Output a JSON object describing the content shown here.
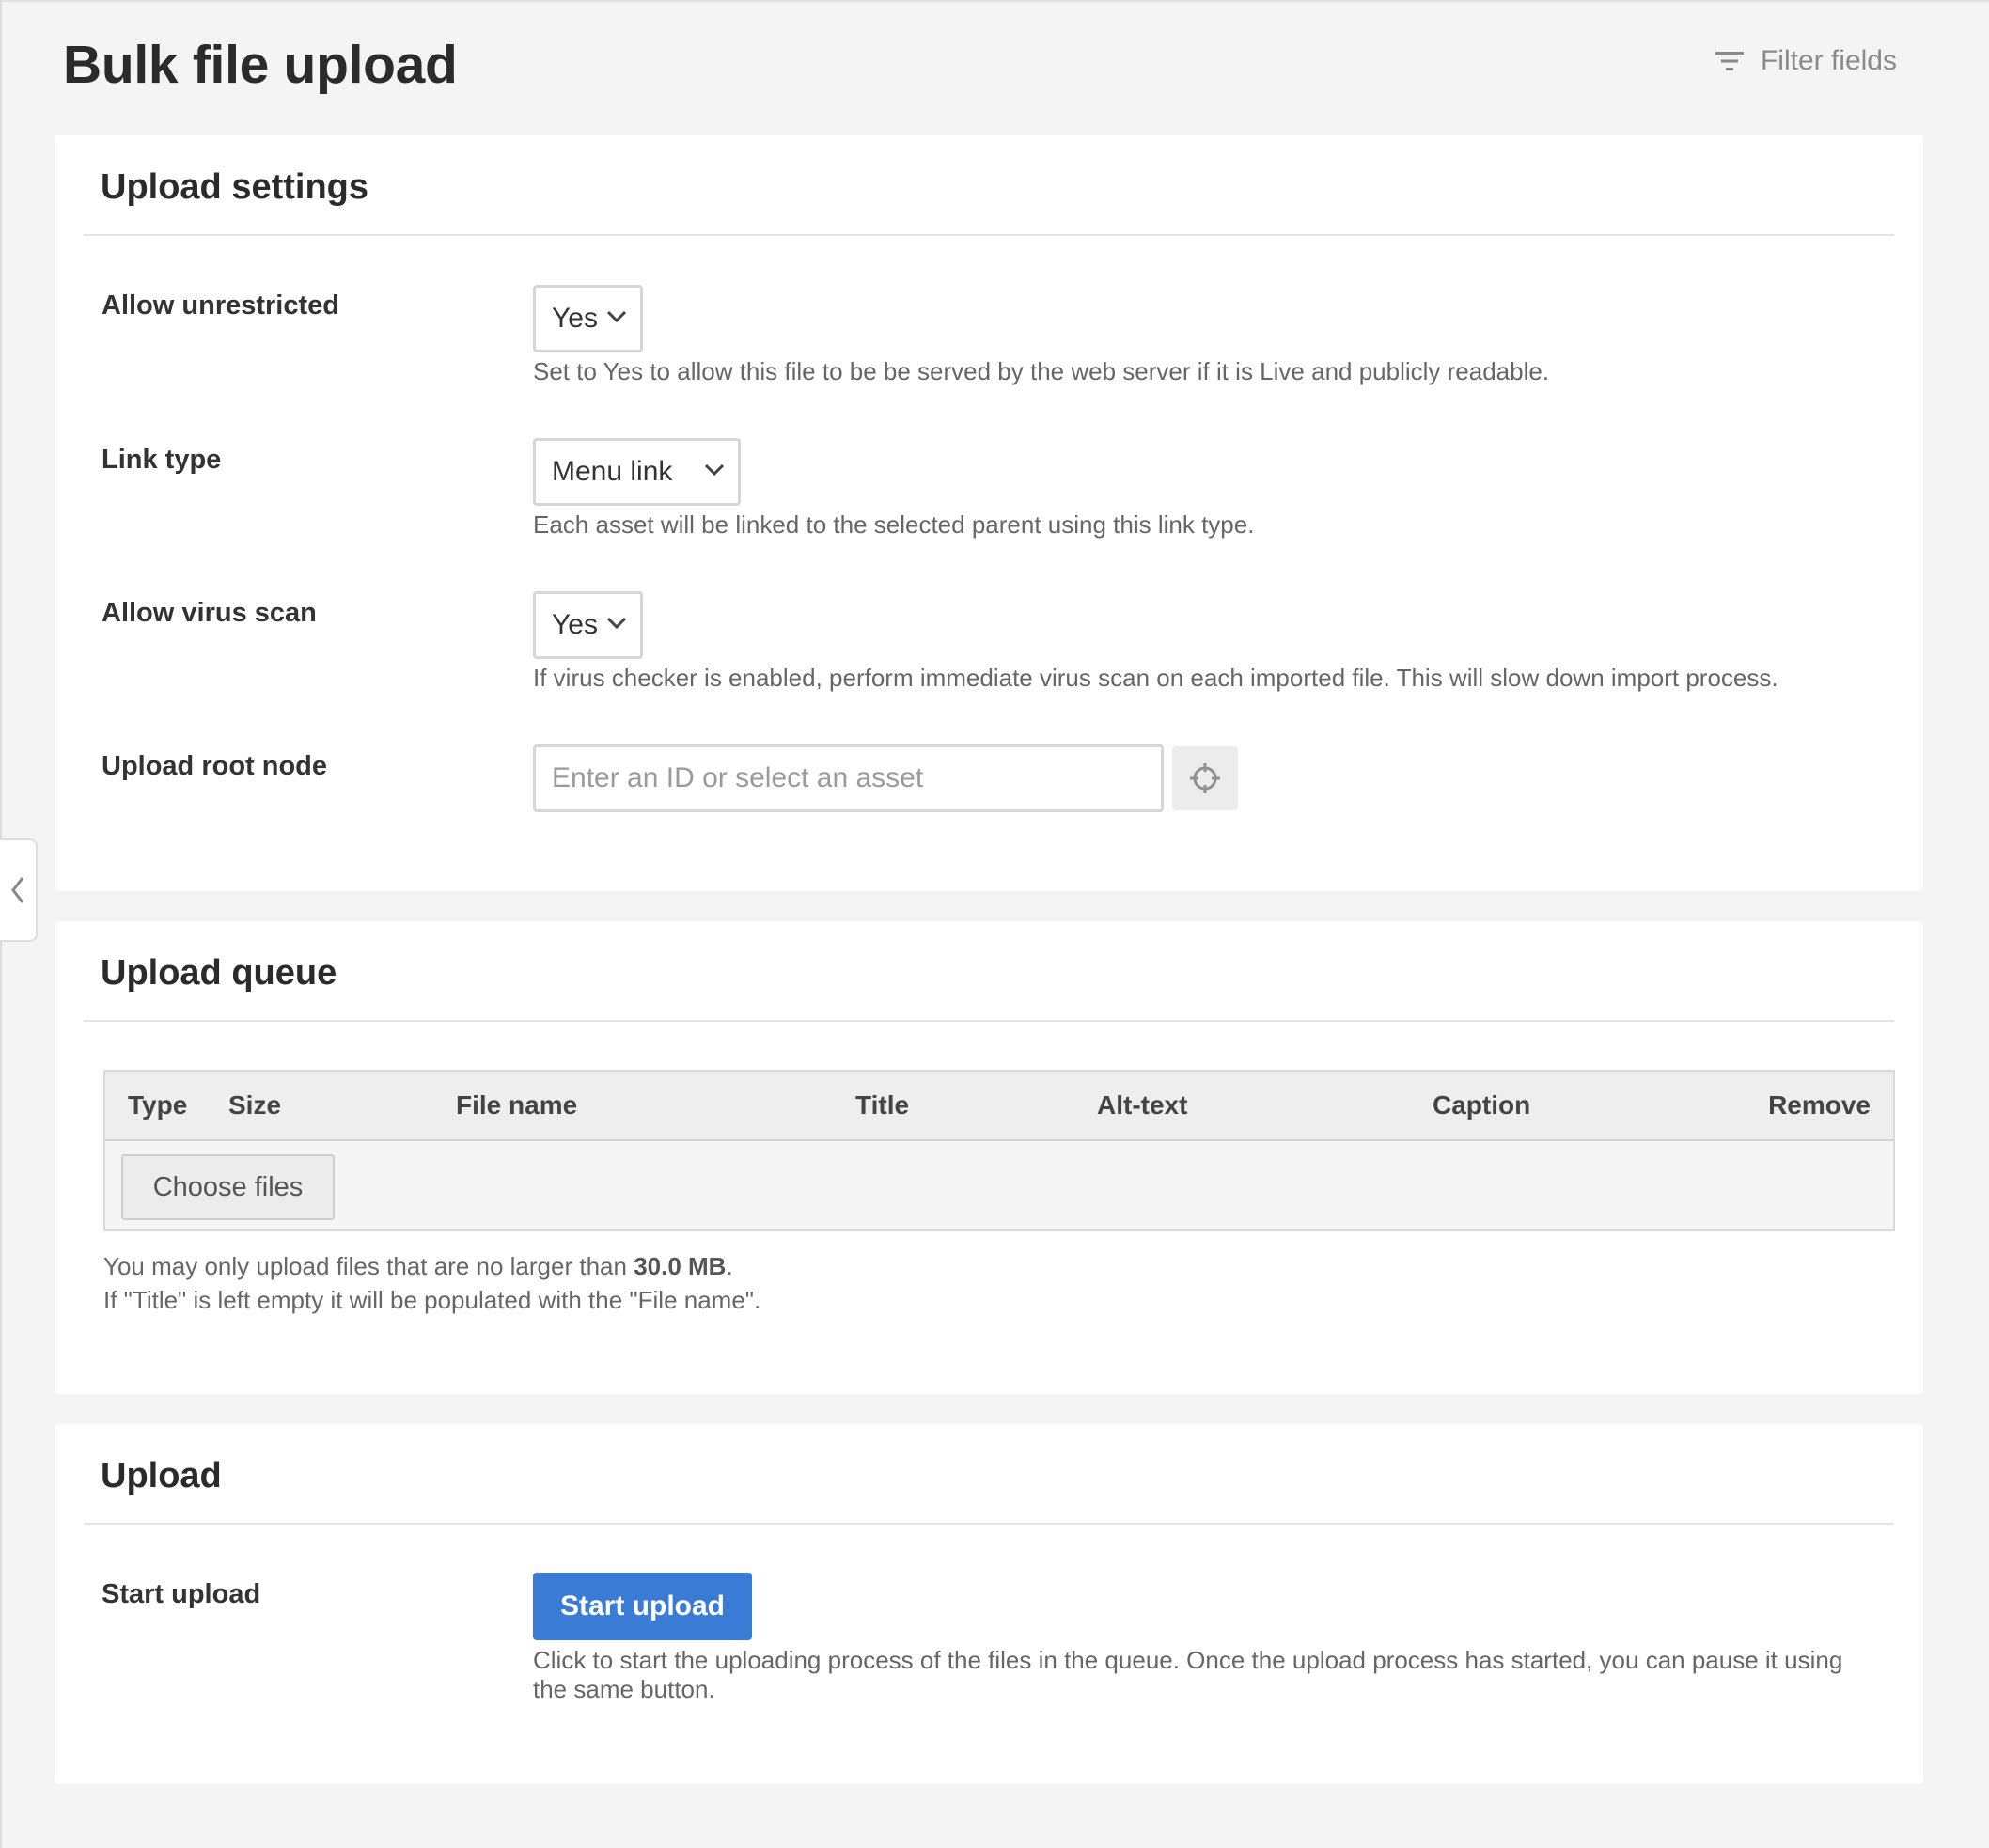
{
  "header": {
    "title": "Bulk file upload",
    "filter_label": "Filter fields"
  },
  "settings": {
    "title": "Upload settings",
    "allow_unrestricted": {
      "label": "Allow unrestricted",
      "value": "Yes",
      "help": "Set to Yes to allow this file to be be served by the web server if it is Live and publicly readable."
    },
    "link_type": {
      "label": "Link type",
      "value": "Menu link",
      "help": "Each asset will be linked to the selected parent using this link type."
    },
    "allow_virus_scan": {
      "label": "Allow virus scan",
      "value": "Yes",
      "help": "If virus checker is enabled, perform immediate virus scan on each imported file. This will slow down import process."
    },
    "root_node": {
      "label": "Upload root node",
      "value": "",
      "placeholder": "Enter an ID or select an asset"
    }
  },
  "queue": {
    "title": "Upload queue",
    "columns": [
      "Type",
      "Size",
      "File name",
      "Title",
      "Alt-text",
      "Caption",
      "Remove"
    ],
    "choose_files_label": "Choose files",
    "note1_prefix": "You may only upload files that are no larger than ",
    "note1_size": "30.0 MB",
    "note1_suffix": ".",
    "note2": "If \"Title\" is left empty it will be populated with the \"File name\"."
  },
  "upload": {
    "title": "Upload",
    "label": "Start upload",
    "button_label": "Start upload",
    "help": "Click to start the uploading process of the files in the queue. Once the upload process has started, you can pause it using the same button."
  },
  "colors": {
    "primary_button": "#3a7bd5",
    "page_background": "#f4f4f4"
  },
  "icons": {
    "filter": "filter-icon",
    "chevron": "chevron-down-icon",
    "asset_picker": "crosshair-icon",
    "collapse": "chevron-left-icon"
  }
}
